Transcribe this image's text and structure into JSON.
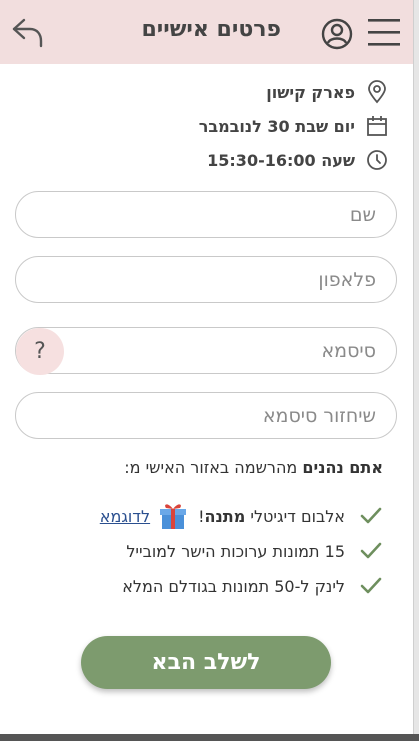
{
  "header": {
    "title": "פרטים אישיים",
    "back_icon": "back-arrow-icon",
    "user_icon": "user-icon",
    "menu_icon": "hamburger-menu-icon"
  },
  "event": {
    "location": "פארק קישון",
    "date": "יום שבת 30 לנובמבר",
    "time": "שעה 15:30-16:00"
  },
  "form": {
    "name_placeholder": "שם",
    "phone_placeholder": "פלאפון",
    "password_placeholder": "סיסמא",
    "password_help": "?",
    "password_confirm_placeholder": "שיחזור סיסמא"
  },
  "benefits": {
    "title_bold": "אתם נהנים",
    "title_rest": " מהרשמה באזור האישי מ:",
    "item1_text": "אלבום דיגיטלי ",
    "item1_bold": "מתנה",
    "item1_suffix": "!",
    "item1_link": "לדוגמא",
    "item2_text": "15 תמונות ערוכות הישר למובייל",
    "item3_text": "לינק ל-50 תמונות בגודלם המלא"
  },
  "next_button": "לשלב הבא",
  "colors": {
    "header_bg": "#f2dede",
    "accent_green": "#7d9b6e",
    "check_green": "#6e8f5e",
    "link_blue": "#2a4f8f"
  }
}
